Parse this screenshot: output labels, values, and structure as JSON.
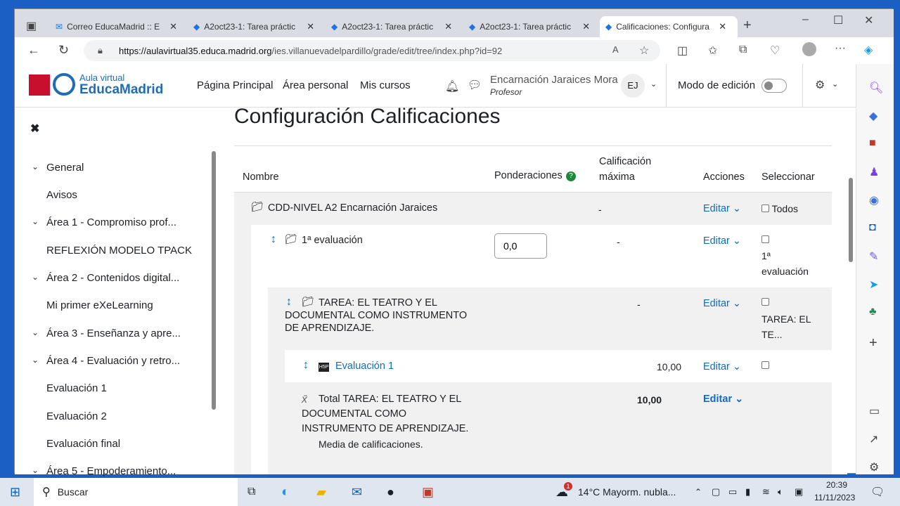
{
  "browser": {
    "tabs": [
      {
        "label": "Correo EducaMadrid :: E"
      },
      {
        "label": "A2oct23-1: Tarea práctic"
      },
      {
        "label": "A2oct23-1: Tarea práctic"
      },
      {
        "label": "A2oct23-1: Tarea práctic"
      },
      {
        "label": "Calificaciones: Configura"
      }
    ],
    "url_host": "https://aulavirtual35.educa.madrid.org",
    "url_path": "/ies.villanuevadelpardillo/grade/edit/tree/index.php?id=92"
  },
  "header": {
    "logo_top": "Aula virtual",
    "logo_main": "EducaMadrid",
    "nav": [
      "Página Principal",
      "Área personal",
      "Mis cursos"
    ],
    "user_name": "Encarnación Jaraices Mora",
    "user_role": "Profesor",
    "initials": "EJ",
    "edit_mode": "Modo de edición",
    "edit_mode_on": false
  },
  "drawer": {
    "items": [
      {
        "label": "General",
        "section": true
      },
      {
        "label": "Avisos"
      },
      {
        "label": "Área 1 - Compromiso prof...",
        "section": true
      },
      {
        "label": "REFLEXIÓN MODELO TPACK"
      },
      {
        "label": "Área 2 - Contenidos digital...",
        "section": true
      },
      {
        "label": "Mi primer eXeLearning"
      },
      {
        "label": "Área 3 - Enseñanza y apre...",
        "section": true
      },
      {
        "label": "Área 4 - Evaluación y retro...",
        "section": true
      },
      {
        "label": "Evaluación 1"
      },
      {
        "label": "Evaluación 2"
      },
      {
        "label": "Evaluación final"
      },
      {
        "label": "Área 5 - Empoderamiento...",
        "section": true
      }
    ]
  },
  "main": {
    "title": "Configuración Calificaciones",
    "cols": {
      "name": "Nombre",
      "weights": "Ponderaciones",
      "max1": "Calificación",
      "max2": "máxima",
      "actions": "Acciones",
      "select": "Seleccionar"
    },
    "edit": "Editar",
    "course": {
      "name": "CDD-NIVEL A2 Encarnación Jaraices",
      "max": "-",
      "select": "Todos"
    },
    "cat1": {
      "name": "1ª evaluación",
      "weight": "0,0",
      "max": "-",
      "select1": "1ª",
      "select2": "evaluación"
    },
    "cat2": {
      "name1": "TAREA: EL TEATRO Y EL",
      "name2": "DOCUMENTAL COMO INSTRUMENTO",
      "name3": "DE APRENDIZAJE.",
      "max": "-",
      "select1": "TAREA: EL",
      "select2": "TE..."
    },
    "item": {
      "name": "Evaluación 1",
      "max": "10,00"
    },
    "total": {
      "name1": "Total TAREA: EL TEATRO Y EL",
      "name2": "DOCUMENTAL COMO",
      "name3": "INSTRUMENTO DE APRENDIZAJE.",
      "max": "10,00",
      "sub": "Media de calificaciones."
    }
  },
  "taskbar": {
    "search": "Buscar",
    "weather": "14°C  Mayorm. nubla...",
    "weather_badge": "1",
    "time": "20:39",
    "date": "11/11/2023"
  }
}
